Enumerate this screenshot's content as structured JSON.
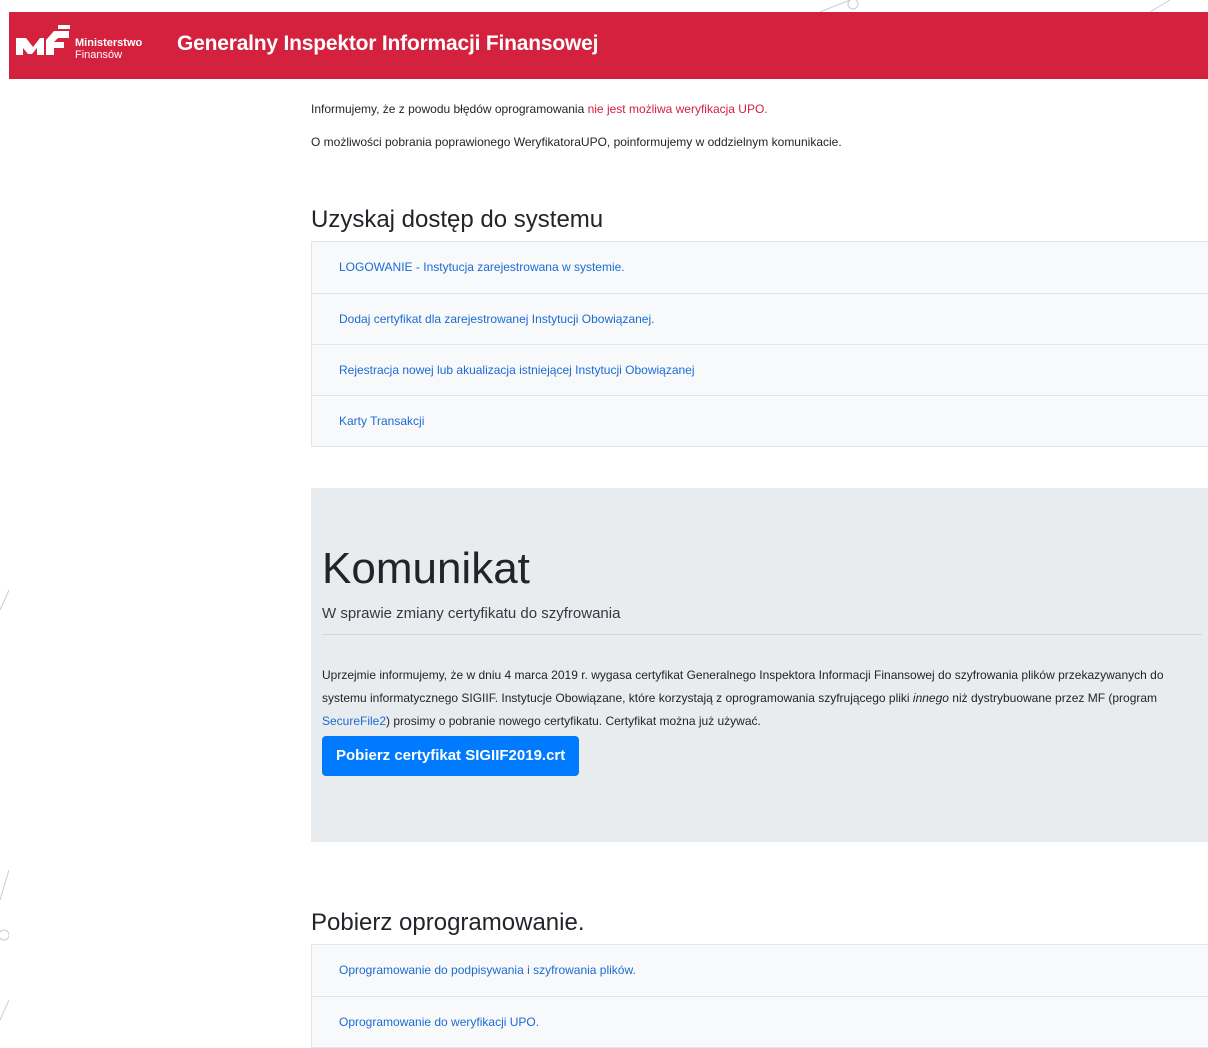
{
  "header": {
    "ministry_line1": "Ministerstwo",
    "ministry_line2": "Finansów",
    "title": "Generalny Inspektor Informacji Finansowej",
    "logo_icon": "mf-logo-icon",
    "background_color": "#d4213d"
  },
  "notices": {
    "line1_prefix": "Informujemy, że z powodu błędów oprogramowania ",
    "line1_alert": "nie jest możliwa weryfikacja UPO.",
    "line2": "O możliwości pobrania poprawionego WeryfikatoraUPO, poinformujemy w oddzielnym komunikacie."
  },
  "access_section": {
    "title": "Uzyskaj dostęp do systemu",
    "links": [
      {
        "label": "LOGOWANIE - Instytucja zarejestrowana w systemie."
      },
      {
        "label": "Dodaj certyfikat dla zarejestrowanej Instytucji Obowiązanej."
      },
      {
        "label": "Rejestracja nowej lub akualizacja istniejącej Instytucji Obowiązanej"
      },
      {
        "label": "Karty Transakcji"
      }
    ]
  },
  "announcement": {
    "title": "Komunikat",
    "lead": "W sprawie zmiany certyfikatu do szyfrowania",
    "para_part1": "Uprzejmie informujemy, że w dniu 4 marca 2019 r. wygasa certyfikat Generalnego Inspektora Informacji Finansowej do szyfrowania plików przekazywanych do systemu informatycznego SIGIIF. Instytucje Obowiązane, które korzystają z oprogramowania szyfrującego pliki ",
    "para_italic": "innego",
    "para_part2": " niż dystrybuowane przez MF (program ",
    "para_link": "SecureFile2",
    "para_part3": ") prosimy o pobranie nowego certyfikatu. Certyfikat można już używać.",
    "button_label": "Pobierz certyfikat SIGIIF2019.crt",
    "button_color": "#007bff"
  },
  "software_section": {
    "title": "Pobierz oprogramowanie.",
    "links": [
      {
        "label": "Oprogramowanie do podpisywania i szyfrowania plików."
      },
      {
        "label": "Oprogramowanie do weryfikacji UPO."
      }
    ]
  },
  "colors": {
    "link": "#1a6bd6",
    "alert": "#d4213d",
    "jumbotron_bg": "#e9ecef"
  }
}
